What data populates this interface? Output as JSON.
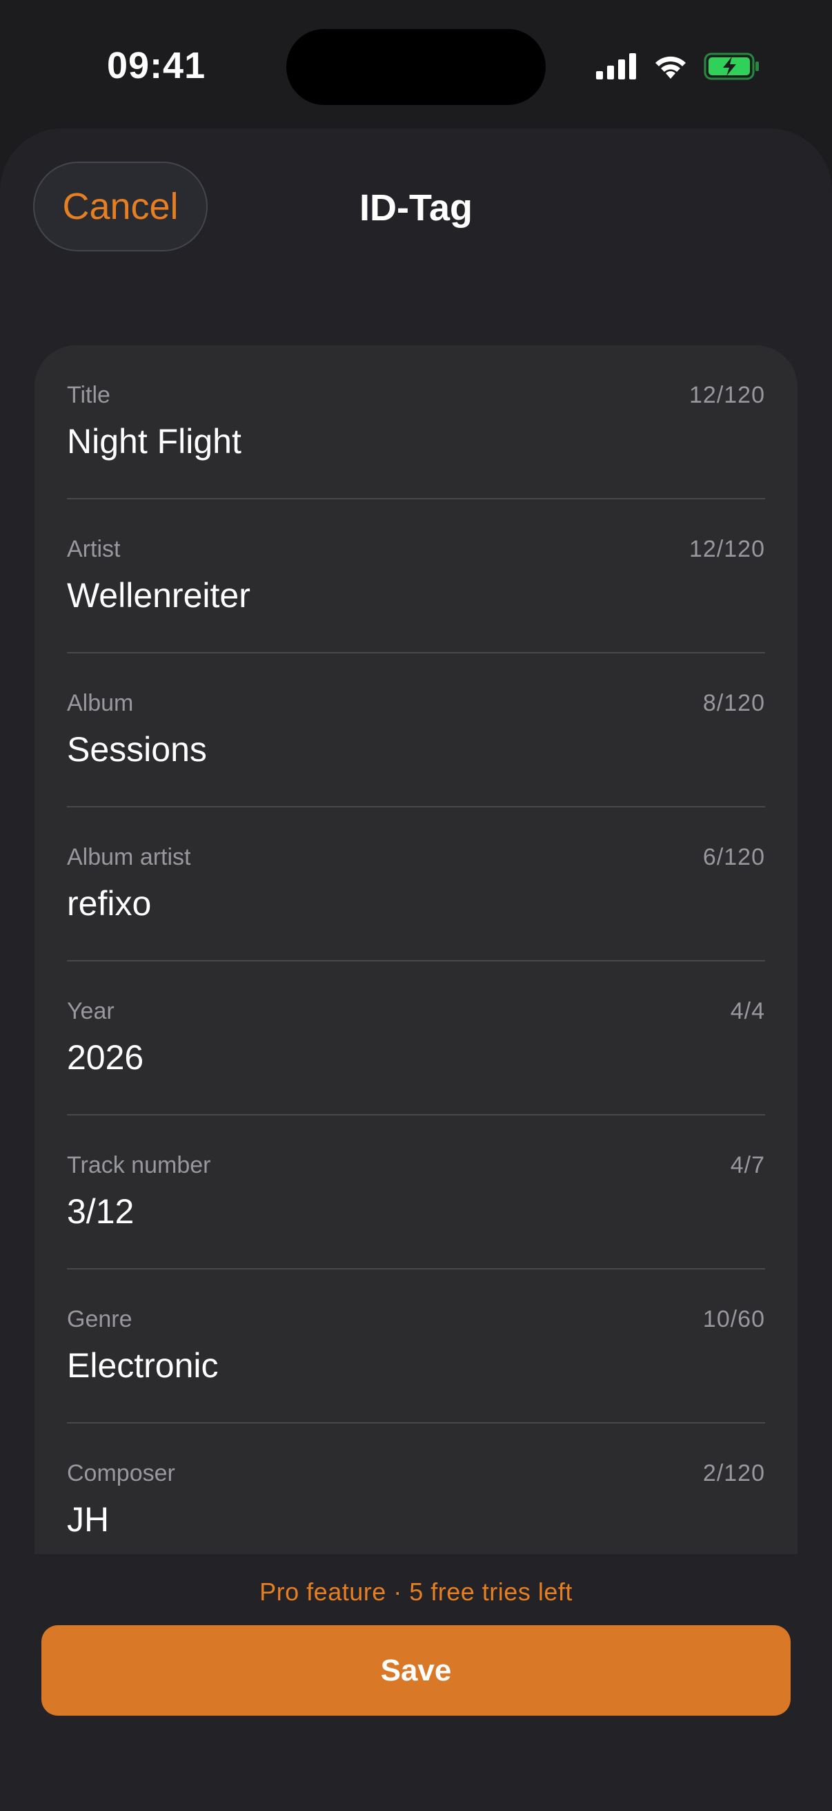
{
  "status_bar": {
    "time": "09:41",
    "icons": [
      "cellular-signal-icon",
      "wifi-icon",
      "battery-charging-icon"
    ],
    "battery_color": "#30d158"
  },
  "header": {
    "cancel_label": "Cancel",
    "title": "ID-Tag"
  },
  "fields": [
    {
      "label": "Title",
      "value": "Night Flight",
      "count": "12/120"
    },
    {
      "label": "Artist",
      "value": "Wellenreiter",
      "count": "12/120"
    },
    {
      "label": "Album",
      "value": "Sessions",
      "count": "8/120"
    },
    {
      "label": "Album artist",
      "value": "refixo",
      "count": "6/120"
    },
    {
      "label": "Year",
      "value": "2026",
      "count": "4/4"
    },
    {
      "label": "Track number",
      "value": "3/12",
      "count": "4/7"
    },
    {
      "label": "Genre",
      "value": "Electronic",
      "count": "10/60"
    },
    {
      "label": "Composer",
      "value": "JH",
      "count": "2/120"
    }
  ],
  "footer": {
    "pro_note": "Pro feature · 5 free tries left",
    "save_label": "Save"
  },
  "colors": {
    "accent": "#e67e22",
    "save_button": "#d97826",
    "background": "#1c1c1e",
    "card": "#2c2c2e"
  }
}
